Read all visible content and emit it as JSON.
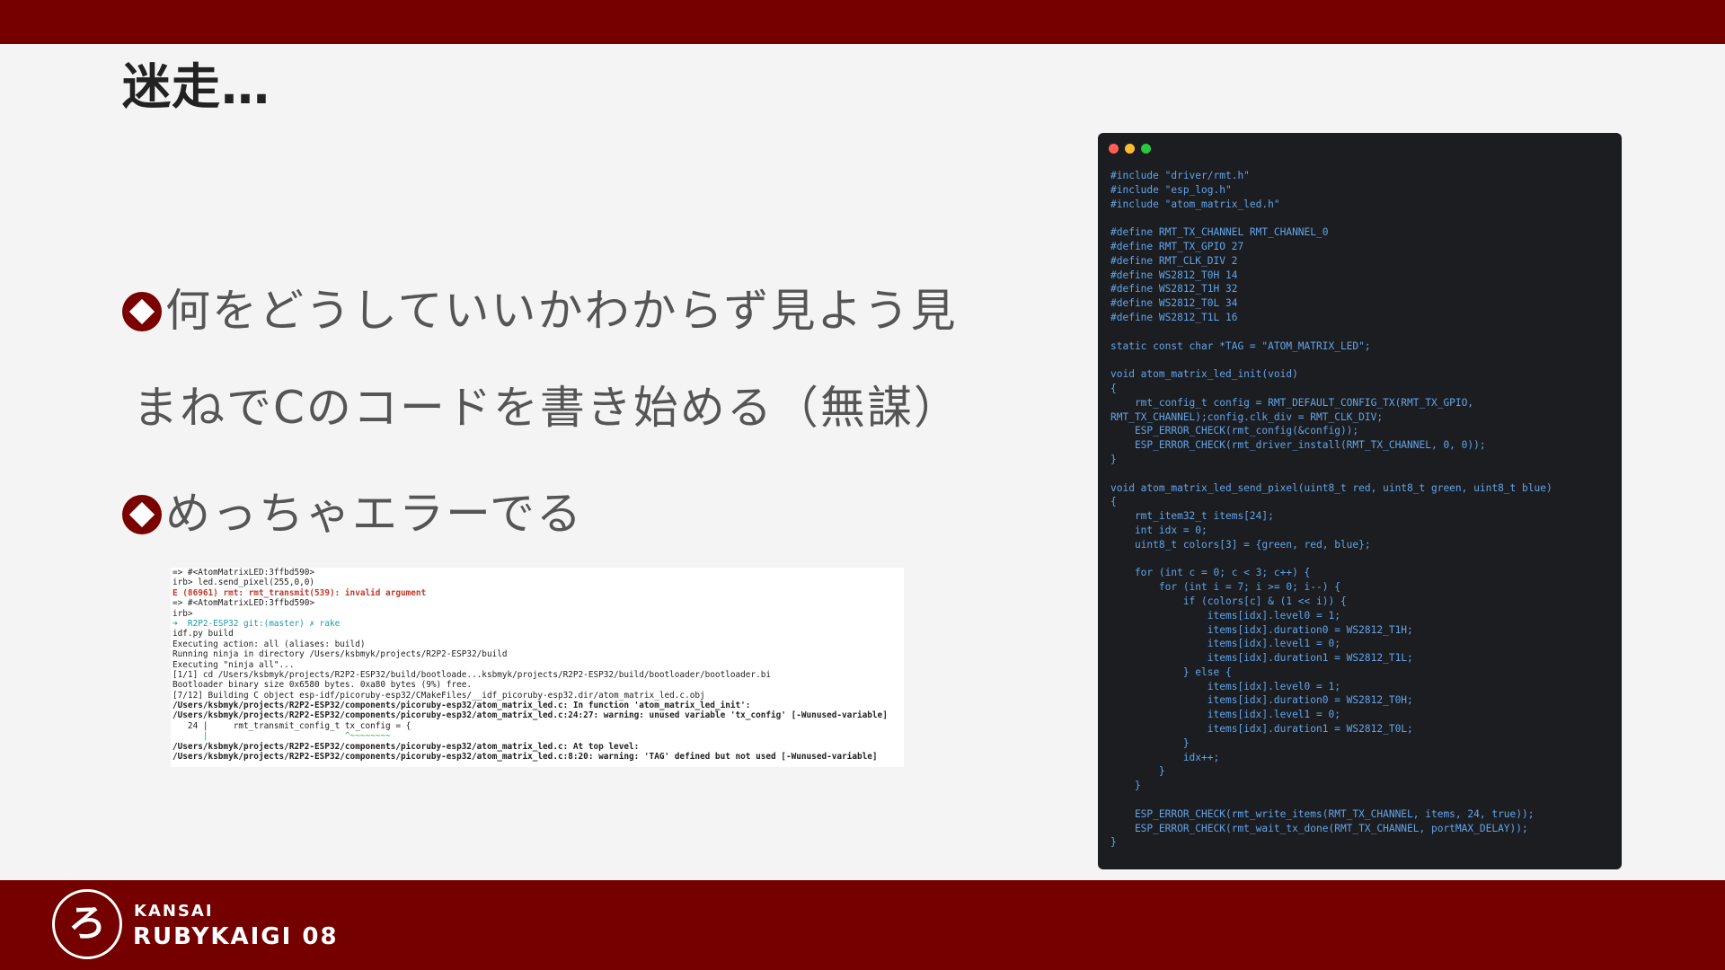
{
  "slide": {
    "title": "迷走…",
    "bullets": [
      "何をどうしていいかわからず見よう見",
      "まねでCのコードを書き始める（無謀）",
      "めっちゃエラーでる"
    ]
  },
  "terminal": {
    "lines": [
      "=> #<AtomMatrixLED:3ffbd590>",
      "irb> led.send_pixel(255,0,0)",
      "E (86961) rmt: rmt_transmit(539): invalid argument",
      "=> #<AtomMatrixLED:3ffbd590>",
      "irb>",
      "➜  R2P2-ESP32 git:(master) ✗ rake",
      "idf.py build",
      "Executing action: all (aliases: build)",
      "Running ninja in directory /Users/ksbmyk/projects/R2P2-ESP32/build",
      "Executing \"ninja all\"...",
      "[1/1] cd /Users/ksbmyk/projects/R2P2-ESP32/build/bootloade...ksbmyk/projects/R2P2-ESP32/build/bootloader/bootloader.bi",
      "Bootloader binary size 0x6580 bytes. 0xa80 bytes (9%) free.",
      "[7/12] Building C object esp-idf/picoruby-esp32/CMakeFiles/__idf_picoruby-esp32.dir/atom_matrix_led.c.obj",
      "/Users/ksbmyk/projects/R2P2-ESP32/components/picoruby-esp32/atom_matrix_led.c: In function 'atom_matrix_led_init':",
      "/Users/ksbmyk/projects/R2P2-ESP32/components/picoruby-esp32/atom_matrix_led.c:24:27: warning: unused variable 'tx_config' [-Wunused-variable]",
      "   24 |     rmt_transmit_config_t tx_config = {",
      "      |                           ^~~~~~~~~",
      "/Users/ksbmyk/projects/R2P2-ESP32/components/picoruby-esp32/atom_matrix_led.c: At top level:",
      "/Users/ksbmyk/projects/R2P2-ESP32/components/picoruby-esp32/atom_matrix_led.c:8:20: warning: 'TAG' defined but not used [-Wunused-variable]"
    ]
  },
  "code": {
    "window_buttons": [
      "close",
      "minimize",
      "zoom"
    ],
    "lines": [
      "#include \"driver/rmt.h\"",
      "#include \"esp_log.h\"",
      "#include \"atom_matrix_led.h\"",
      "",
      "#define RMT_TX_CHANNEL RMT_CHANNEL_0",
      "#define RMT_TX_GPIO 27",
      "#define RMT_CLK_DIV 2",
      "#define WS2812_T0H 14",
      "#define WS2812_T1H 32",
      "#define WS2812_T0L 34",
      "#define WS2812_T1L 16",
      "",
      "static const char *TAG = \"ATOM_MATRIX_LED\";",
      "",
      "void atom_matrix_led_init(void)",
      "{",
      "    rmt_config_t config = RMT_DEFAULT_CONFIG_TX(RMT_TX_GPIO,",
      "RMT_TX_CHANNEL);config.clk_div = RMT_CLK_DIV;",
      "    ESP_ERROR_CHECK(rmt_config(&config));",
      "    ESP_ERROR_CHECK(rmt_driver_install(RMT_TX_CHANNEL, 0, 0));",
      "}",
      "",
      "void atom_matrix_led_send_pixel(uint8_t red, uint8_t green, uint8_t blue)",
      "{",
      "    rmt_item32_t items[24];",
      "    int idx = 0;",
      "    uint8_t colors[3] = {green, red, blue};",
      "",
      "    for (int c = 0; c < 3; c++) {",
      "        for (int i = 7; i >= 0; i--) {",
      "            if (colors[c] & (1 << i)) {",
      "                items[idx].level0 = 1;",
      "                items[idx].duration0 = WS2812_T1H;",
      "                items[idx].level1 = 0;",
      "                items[idx].duration1 = WS2812_T1L;",
      "            } else {",
      "                items[idx].level0 = 1;",
      "                items[idx].duration0 = WS2812_T0H;",
      "                items[idx].level1 = 0;",
      "                items[idx].duration1 = WS2812_T0L;",
      "            }",
      "            idx++;",
      "        }",
      "    }",
      "",
      "    ESP_ERROR_CHECK(rmt_write_items(RMT_TX_CHANNEL, items, 24, true));",
      "    ESP_ERROR_CHECK(rmt_wait_tx_done(RMT_TX_CHANNEL, portMAX_DELAY));",
      "}"
    ]
  },
  "footer": {
    "logo_text": "ろ",
    "brand_line1": "KANSAI",
    "brand_line2": "RUBYKAIGI 08"
  },
  "colors": {
    "brand_red": "#740000",
    "background": "#f4f4f4",
    "code_bg": "#1b1d21",
    "code_text": "#63a4e8"
  }
}
